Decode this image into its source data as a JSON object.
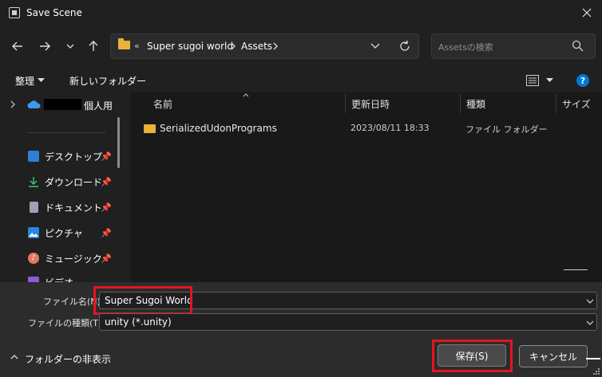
{
  "window": {
    "title": "Save Scene"
  },
  "address": {
    "overflow": "«",
    "crumbs": [
      "Super sugoi world",
      "Assets"
    ]
  },
  "search": {
    "placeholder": "Assetsの検索"
  },
  "toolbar": {
    "organize": "整理",
    "new_folder": "新しいフォルダー"
  },
  "sidebar": {
    "top_item": "個人用",
    "items": [
      {
        "label": "デスクトップ",
        "icon": "desktop-icon"
      },
      {
        "label": "ダウンロード",
        "icon": "download-icon"
      },
      {
        "label": "ドキュメント",
        "icon": "document-icon"
      },
      {
        "label": "ピクチャ",
        "icon": "pictures-icon"
      },
      {
        "label": "ミュージック",
        "icon": "music-icon"
      },
      {
        "label": "ビデオ",
        "icon": "video-icon"
      }
    ]
  },
  "columns": {
    "name": "名前",
    "date": "更新日時",
    "type": "種類",
    "size": "サイズ"
  },
  "files": [
    {
      "name": "SerializedUdonPrograms",
      "date": "2023/08/11 18:33",
      "type": "ファイル フォルダー",
      "size": ""
    }
  ],
  "filename": {
    "label": "ファイル名(N):",
    "value": "Super Sugoi World"
  },
  "filetype": {
    "label": "ファイルの種類(T):",
    "value": "unity (*.unity)"
  },
  "footer": {
    "hide_folders": "フォルダーの非表示",
    "save": "保存(S)",
    "cancel": "キャンセル"
  },
  "colors": {
    "accent": "#0078d4",
    "folder": "#e9b23b",
    "highlight": "#e5141f"
  }
}
